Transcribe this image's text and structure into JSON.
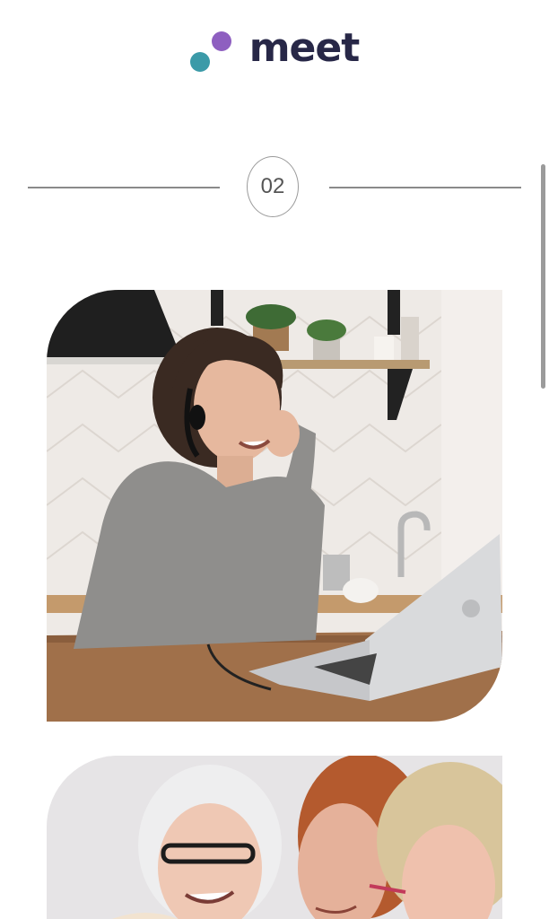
{
  "brand": {
    "name": "meet",
    "colors": {
      "purple": "#8e5fc0",
      "teal": "#3b9aa8",
      "text": "#272747"
    }
  },
  "step": {
    "number": "02"
  },
  "images": [
    {
      "icon": "woman-with-headset-at-laptop-photo"
    },
    {
      "icon": "three-women-smiling-photo"
    }
  ]
}
